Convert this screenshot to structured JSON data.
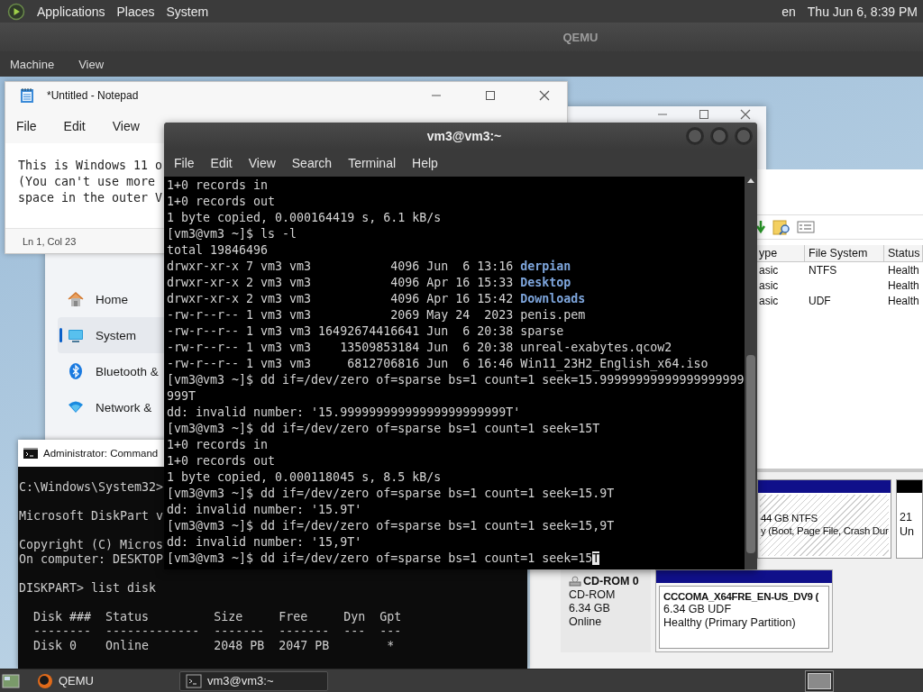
{
  "top_panel": {
    "menus": [
      "Applications",
      "Places",
      "System"
    ],
    "keyboard": "en",
    "clock": "Thu Jun 6, 8:39 PM"
  },
  "qemu": {
    "title": "QEMU",
    "menus": [
      "Machine",
      "View"
    ]
  },
  "settings": {
    "nav": [
      {
        "label": "Home",
        "selected": false
      },
      {
        "label": "System",
        "selected": true
      },
      {
        "label": "Bluetooth &",
        "selected": false
      },
      {
        "label": "Network &",
        "selected": false
      }
    ]
  },
  "notepad": {
    "title": "*Untitled - Notepad",
    "menus": [
      "File",
      "Edit",
      "View"
    ],
    "lines": [
      "This is Windows 11 o",
      "(You can't use more",
      "space in the outer V"
    ],
    "status": "Ln 1, Col 23"
  },
  "disk_management": {
    "columns": [
      "ype",
      "File System",
      "Status"
    ],
    "rows": [
      {
        "type": "asic",
        "file_system": "NTFS",
        "status": "Health"
      },
      {
        "type": "asic",
        "status": "Health"
      },
      {
        "type": "asic",
        "file_system": "UDF",
        "status": "Health"
      }
    ],
    "disk_0_volumes": [
      {
        "size": "44 GB NTFS",
        "status": "y (Boot, Page File, Crash Dur"
      },
      {
        "size": "21",
        "status": "Un"
      }
    ],
    "cdrom": {
      "name": "CD-ROM 0",
      "type": "CD-ROM",
      "size": "6.34 GB",
      "state": "Online"
    },
    "cd_volume": {
      "label": "CCCOMA_X64FRE_EN-US_DV9 (",
      "size": "6.34 GB UDF",
      "status": "Healthy (Primary Partition)"
    }
  },
  "cmd": {
    "title": "Administrator: Command",
    "blocks": [
      [
        "C:\\Windows\\System32>"
      ],
      [
        "Microsoft DiskPart v"
      ],
      [
        "Copyright (C) Micros",
        "On computer: DESKTOP"
      ],
      [
        "DISKPART> list disk"
      ],
      [
        "  Disk ###  Status         Size     Free     Dyn  Gpt",
        "  --------  -------------  -------  -------  ---  ---",
        "  Disk 0    Online         2048 PB  2047 PB        *"
      ]
    ]
  },
  "terminal": {
    "title": "vm3@vm3:~",
    "menus": [
      "File",
      "Edit",
      "View",
      "Search",
      "Terminal",
      "Help"
    ],
    "lines": [
      {
        "text": "1+0 records in"
      },
      {
        "text": "1+0 records out"
      },
      {
        "text": "1 byte copied, 0.000164419 s, 6.1 kB/s"
      },
      {
        "text": "[vm3@vm3 ~]$ ls -l"
      },
      {
        "text": "total 19846496"
      },
      {
        "text": "drwxr-xr-x 7 vm3 vm3           4096 Jun  6 13:16 **derpian**"
      },
      {
        "text": "drwxr-xr-x 2 vm3 vm3           4096 Apr 16 15:33 **Desktop**"
      },
      {
        "text": "drwxr-xr-x 2 vm3 vm3           4096 Apr 16 15:42 **Downloads**"
      },
      {
        "text": "-rw-r--r-- 1 vm3 vm3           2069 May 24  2023 penis.pem"
      },
      {
        "text": "-rw-r--r-- 1 vm3 vm3 16492674416641 Jun  6 20:38 sparse"
      },
      {
        "text": "-rw-r--r-- 1 vm3 vm3    13509853184 Jun  6 20:38 unreal-exabytes.qcow2"
      },
      {
        "text": "-rw-r--r-- 1 vm3 vm3     6812706816 Jun  6 16:46 Win11_23H2_English_x64.iso"
      },
      {
        "text": "[vm3@vm3 ~]$ dd if=/dev/zero of=sparse bs=1 count=1 seek=15.99999999999999999999"
      },
      {
        "text": "999T"
      },
      {
        "text": "dd: invalid number: '15.99999999999999999999999T'"
      },
      {
        "text": "[vm3@vm3 ~]$ dd if=/dev/zero of=sparse bs=1 count=1 seek=15T"
      },
      {
        "text": "1+0 records in"
      },
      {
        "text": "1+0 records out"
      },
      {
        "text": "1 byte copied, 0.000118045 s, 8.5 kB/s"
      },
      {
        "text": "[vm3@vm3 ~]$ dd if=/dev/zero of=sparse bs=1 count=1 seek=15.9T"
      },
      {
        "text": "dd: invalid number: '15.9T'"
      },
      {
        "text": "[vm3@vm3 ~]$ dd if=/dev/zero of=sparse bs=1 count=1 seek=15,9T"
      },
      {
        "text": "dd: invalid number: '15,9T'"
      },
      {
        "text": "[vm3@vm3 ~]$ dd if=/dev/zero of=sparse bs=1 count=1 seek=15",
        "cursor": "T"
      }
    ]
  },
  "taskbar": {
    "items": [
      {
        "label": "QEMU",
        "selected": false
      },
      {
        "label": "vm3@vm3:~",
        "selected": true
      }
    ]
  }
}
